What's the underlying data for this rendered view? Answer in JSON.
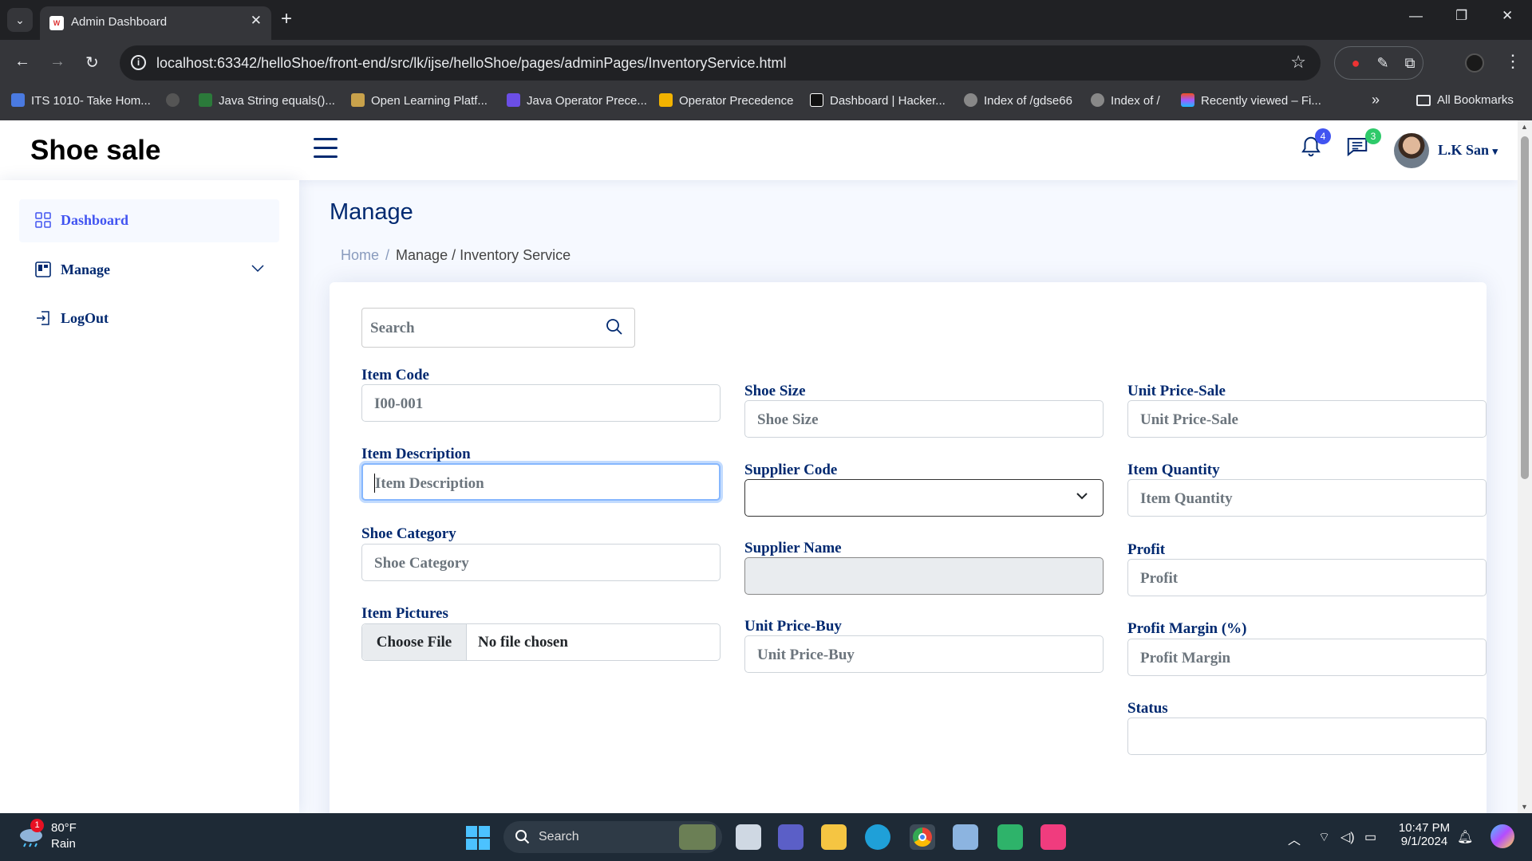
{
  "browser": {
    "tab_title": "Admin Dashboard",
    "url": "localhost:63342/helloShoe/front-end/src/lk/ijse/helloShoe/pages/adminPages/InventoryService.html",
    "bookmarks": [
      "ITS 1010- Take Hom...",
      "Java String equals()...",
      "Open Learning Platf...",
      "Java Operator Prece...",
      "Operator Precedence",
      "Dashboard | Hacker...",
      "Index of /gdse66",
      "Index of /",
      "Recently viewed – Fi..."
    ],
    "all_bookmarks": "All Bookmarks",
    "more": "»"
  },
  "header": {
    "logo": "Shoe sale",
    "notifications_count": "4",
    "messages_count": "3",
    "user_name": "L.K San",
    "notif_color": "#4154f1",
    "msg_color": "#2eca6a"
  },
  "sidebar": {
    "items": [
      {
        "label": "Dashboard",
        "icon": "grid-icon"
      },
      {
        "label": "Manage",
        "icon": "layout-icon"
      },
      {
        "label": "LogOut",
        "icon": "box-arrow-in-right-icon"
      }
    ]
  },
  "main": {
    "page_title": "Manage",
    "breadcrumb": {
      "home": "Home",
      "separator": "/",
      "current": "Manage / Inventory Service"
    },
    "search_placeholder": "Search",
    "form": {
      "item_code": {
        "label": "Item Code",
        "value": "I00-001"
      },
      "item_description": {
        "label": "Item Description",
        "placeholder": "Item Description"
      },
      "shoe_category": {
        "label": "Shoe Category",
        "placeholder": "Shoe Category"
      },
      "item_pictures": {
        "label": "Item Pictures",
        "button": "Choose File",
        "status": "No file chosen"
      },
      "shoe_size": {
        "label": "Shoe Size",
        "placeholder": "Shoe Size"
      },
      "supplier_code": {
        "label": "Supplier Code",
        "value": ""
      },
      "supplier_name": {
        "label": "Supplier Name",
        "value": ""
      },
      "unit_price_buy": {
        "label": "Unit Price-Buy",
        "placeholder": "Unit Price-Buy"
      },
      "unit_price_sale": {
        "label": "Unit Price-Sale",
        "placeholder": "Unit Price-Sale"
      },
      "item_quantity": {
        "label": "Item Quantity",
        "placeholder": "Item Quantity"
      },
      "profit": {
        "label": "Profit",
        "placeholder": "Profit"
      },
      "profit_margin": {
        "label": "Profit Margin (%)",
        "placeholder": "Profit Margin"
      },
      "status": {
        "label": "Status",
        "value": ""
      }
    }
  },
  "taskbar": {
    "weather_temp": "80°F",
    "weather_cond": "Rain",
    "weather_badge": "1",
    "search": "Search",
    "time": "10:47 PM",
    "date": "9/1/2024"
  }
}
